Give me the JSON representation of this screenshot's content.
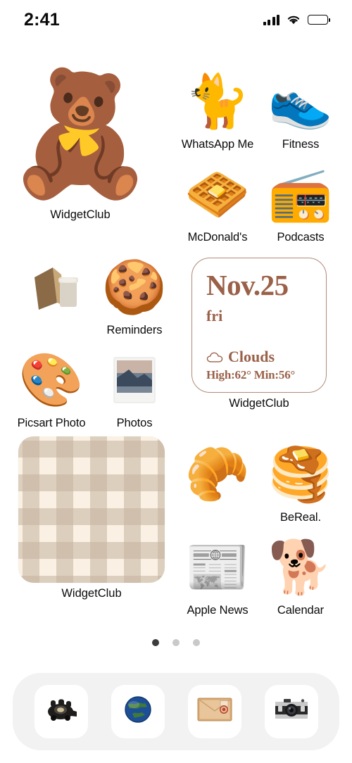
{
  "status_bar": {
    "time": "2:41",
    "cellular_icon": "signal-bars-icon",
    "wifi_icon": "wifi-icon",
    "battery_icon": "battery-full-icon"
  },
  "home_screen": {
    "apps": [
      {
        "label": "",
        "icon": "paper-bag-coffee",
        "glyph": "🥤",
        "art": "bag"
      },
      {
        "label": "Reminders",
        "icon": "cookie",
        "glyph": "🍪"
      },
      {
        "label": "WhatsApp Me",
        "icon": "tuxedo-cat",
        "glyph": "🐈"
      },
      {
        "label": "Fitness",
        "icon": "white-sneaker",
        "glyph": "👟"
      },
      {
        "label": "McDonald's",
        "icon": "waffle",
        "glyph": "🧇"
      },
      {
        "label": "Podcasts",
        "icon": "retro-radio",
        "glyph": "📻"
      },
      {
        "label": "Picsart Photo",
        "icon": "paint-palette",
        "glyph": "🎨"
      },
      {
        "label": "Photos",
        "icon": "polaroid-photo",
        "glyph": "🏔"
      },
      {
        "label": "",
        "icon": "croissant",
        "glyph": "🥐"
      },
      {
        "label": "BeReal.",
        "icon": "pancakes",
        "glyph": "🥞"
      },
      {
        "label": "Apple News",
        "icon": "newspaper",
        "glyph": "📰"
      },
      {
        "label": "Calendar",
        "icon": "puppy-and-kitten",
        "glyph": "🐕"
      }
    ],
    "widgets": {
      "teddy_bear": {
        "label": "WidgetClub",
        "icon": "teddy-bear",
        "glyph": "🧸"
      },
      "gingham": {
        "label": "WidgetClub",
        "icon": "gingham-pattern",
        "base_color": "#faf1e4",
        "check_color": "#c4b29e"
      },
      "weather": {
        "label": "WidgetClub",
        "date": "Nov.25",
        "weekday": "fri",
        "condition": "Clouds",
        "condition_icon": "cloud-icon",
        "temps": "High:62° Min:56°",
        "accent_color": "#9a6148",
        "border_color": "#b08a76"
      }
    },
    "page_dots": {
      "count": 3,
      "active_index": 0
    }
  },
  "dock": {
    "items": [
      {
        "label": "Phone",
        "icon": "rotary-telephone",
        "glyph": "☎"
      },
      {
        "label": "Safari",
        "icon": "globe-earth",
        "glyph": "🌍"
      },
      {
        "label": "Mail",
        "icon": "envelope",
        "glyph": "✉"
      },
      {
        "label": "Camera",
        "icon": "vintage-camera",
        "glyph": "📷"
      }
    ]
  }
}
